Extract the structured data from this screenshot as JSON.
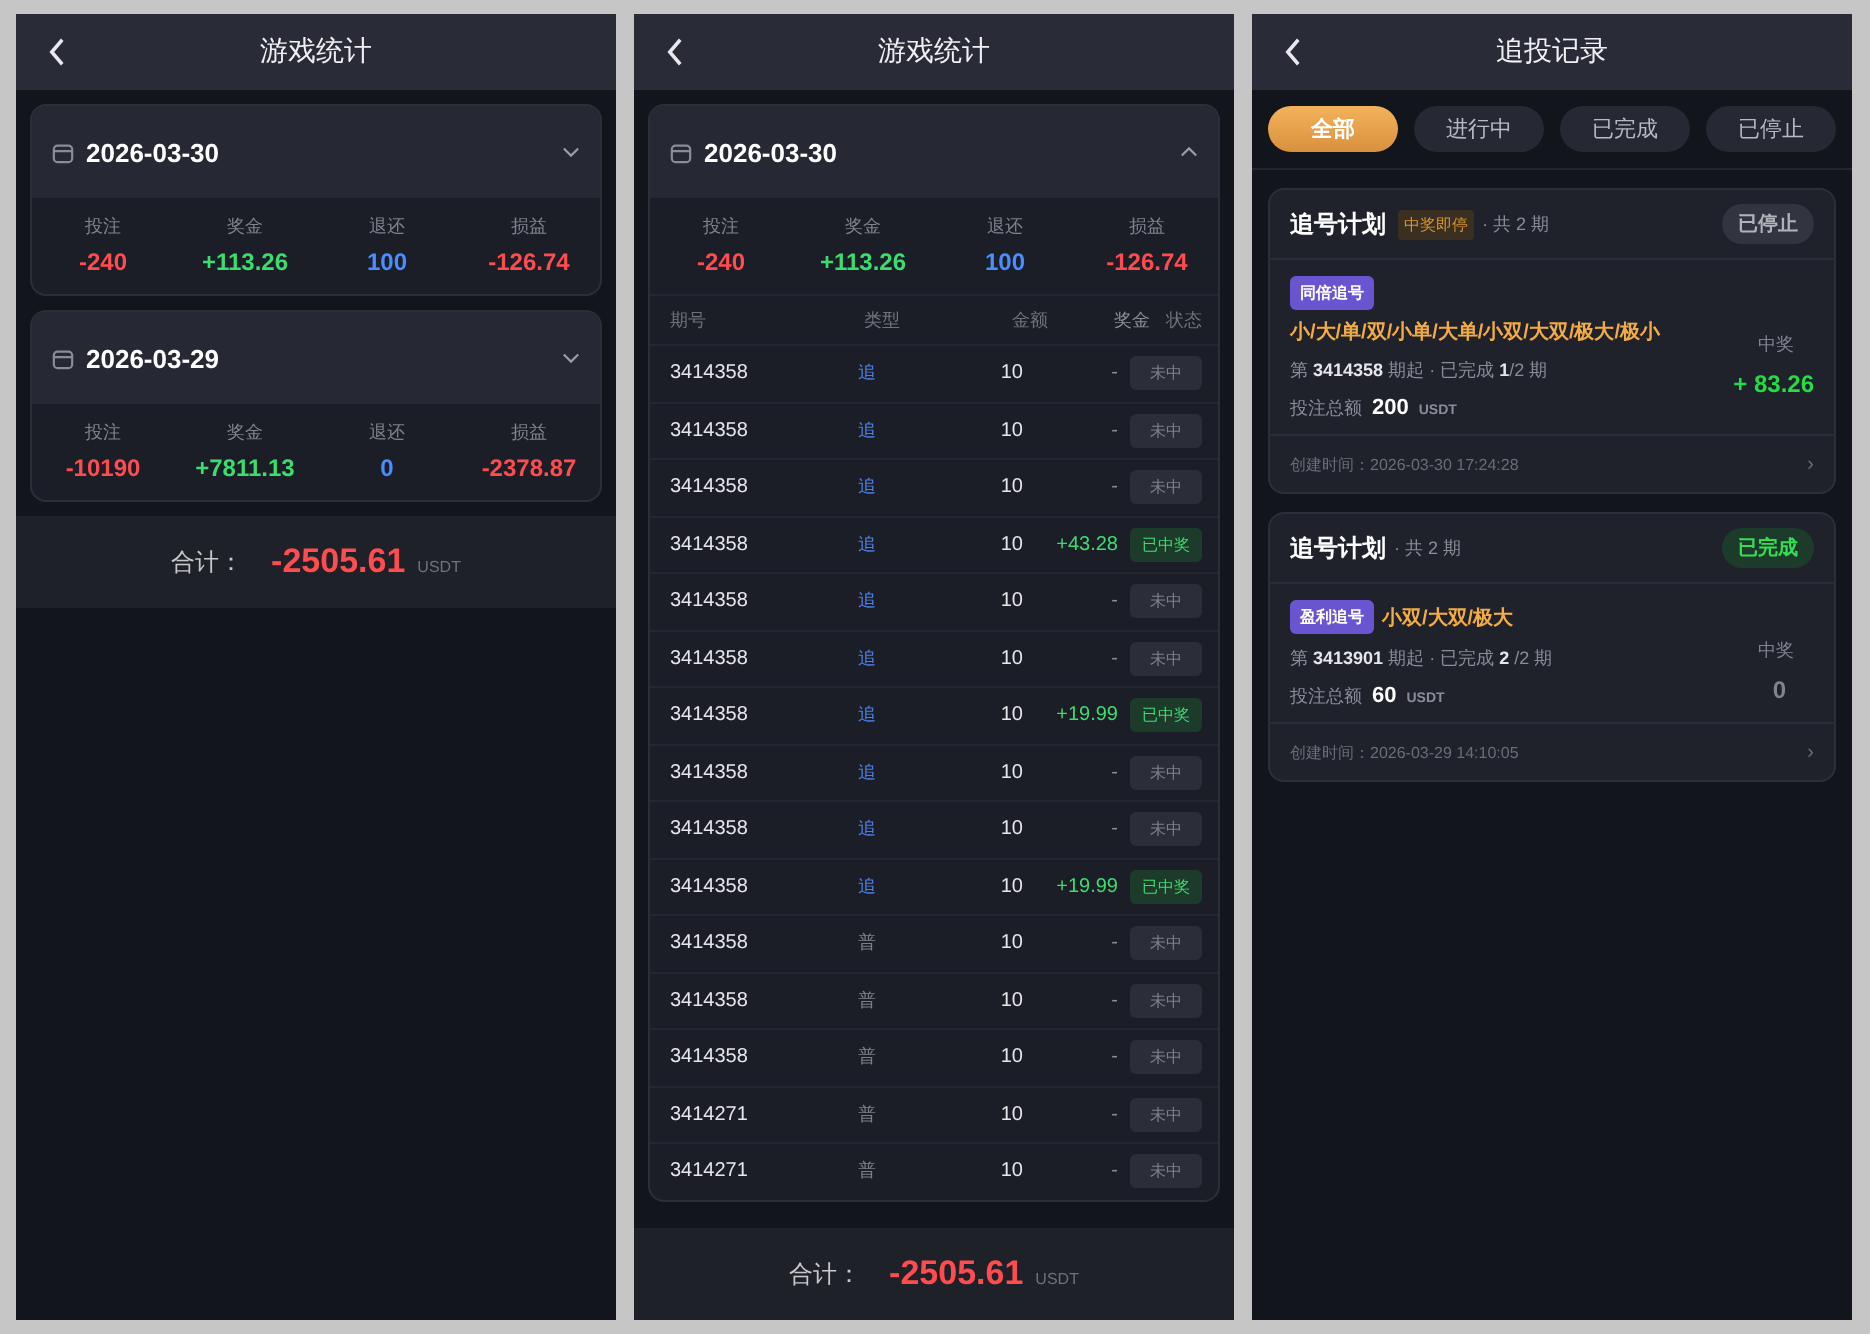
{
  "screens": [
    {
      "kind": "stats",
      "title": "游戏统计",
      "days": [
        {
          "date": "2026-03-30",
          "expanded": false,
          "stats": [
            {
              "label": "投注",
              "value": "-240",
              "color": "#ff4d4f"
            },
            {
              "label": "奖金",
              "value": "+113.26",
              "color": "#3ddc6f"
            },
            {
              "label": "退还",
              "value": "100",
              "color": "#4a8dff"
            },
            {
              "label": "损益",
              "value": "-126.74",
              "color": "#ff4d4f"
            }
          ]
        },
        {
          "date": "2026-03-29",
          "expanded": false,
          "stats": [
            {
              "label": "投注",
              "value": "-10190",
              "color": "#ff4d4f"
            },
            {
              "label": "奖金",
              "value": "+7811.13",
              "color": "#3ddc6f"
            },
            {
              "label": "退还",
              "value": "0",
              "color": "#4a8dff"
            },
            {
              "label": "损益",
              "value": "-2378.87",
              "color": "#ff4d4f"
            }
          ]
        }
      ],
      "total": {
        "label": "合计：",
        "value": "-2505.61",
        "unit": "USDT"
      }
    },
    {
      "kind": "stats",
      "title": "游戏统计",
      "days": [
        {
          "date": "2026-03-30",
          "expanded": true,
          "stats": [
            {
              "label": "投注",
              "value": "-240",
              "color": "#ff4d4f"
            },
            {
              "label": "奖金",
              "value": "+113.26",
              "color": "#3ddc6f"
            },
            {
              "label": "退还",
              "value": "100",
              "color": "#4a8dff"
            },
            {
              "label": "损益",
              "value": "-126.74",
              "color": "#ff4d4f"
            }
          ],
          "table": {
            "columns": [
              "期号",
              "类型",
              "金额",
              "奖金",
              "状态"
            ],
            "rows": [
              {
                "period": "3414358",
                "type": "追",
                "kind": "chase",
                "amount": "10",
                "prize": "-",
                "status": "未中",
                "won": false
              },
              {
                "period": "3414358",
                "type": "追",
                "kind": "chase",
                "amount": "10",
                "prize": "-",
                "status": "未中",
                "won": false
              },
              {
                "period": "3414358",
                "type": "追",
                "kind": "chase",
                "amount": "10",
                "prize": "-",
                "status": "未中",
                "won": false
              },
              {
                "period": "3414358",
                "type": "追",
                "kind": "chase",
                "amount": "10",
                "prize": "+43.28",
                "status": "已中奖",
                "won": true
              },
              {
                "period": "3414358",
                "type": "追",
                "kind": "chase",
                "amount": "10",
                "prize": "-",
                "status": "未中",
                "won": false
              },
              {
                "period": "3414358",
                "type": "追",
                "kind": "chase",
                "amount": "10",
                "prize": "-",
                "status": "未中",
                "won": false
              },
              {
                "period": "3414358",
                "type": "追",
                "kind": "chase",
                "amount": "10",
                "prize": "+19.99",
                "status": "已中奖",
                "won": true
              },
              {
                "period": "3414358",
                "type": "追",
                "kind": "chase",
                "amount": "10",
                "prize": "-",
                "status": "未中",
                "won": false
              },
              {
                "period": "3414358",
                "type": "追",
                "kind": "chase",
                "amount": "10",
                "prize": "-",
                "status": "未中",
                "won": false
              },
              {
                "period": "3414358",
                "type": "追",
                "kind": "chase",
                "amount": "10",
                "prize": "+19.99",
                "status": "已中奖",
                "won": true
              },
              {
                "period": "3414358",
                "type": "普",
                "kind": "normal",
                "amount": "10",
                "prize": "-",
                "status": "未中",
                "won": false
              },
              {
                "period": "3414358",
                "type": "普",
                "kind": "normal",
                "amount": "10",
                "prize": "-",
                "status": "未中",
                "won": false
              },
              {
                "period": "3414358",
                "type": "普",
                "kind": "normal",
                "amount": "10",
                "prize": "-",
                "status": "未中",
                "won": false
              },
              {
                "period": "3414271",
                "type": "普",
                "kind": "normal",
                "amount": "10",
                "prize": "-",
                "status": "未中",
                "won": false
              },
              {
                "period": "3414271",
                "type": "普",
                "kind": "normal",
                "amount": "10",
                "prize": "-",
                "status": "未中",
                "won": false
              }
            ]
          }
        }
      ],
      "total": {
        "label": "合计：",
        "value": "-2505.61",
        "unit": "USDT"
      }
    },
    {
      "kind": "records",
      "title": "追投记录",
      "filters": [
        {
          "label": "全部",
          "selected": true
        },
        {
          "label": "进行中",
          "selected": false
        },
        {
          "label": "已完成",
          "selected": false
        },
        {
          "label": "已停止",
          "selected": false
        }
      ],
      "records": [
        {
          "title": "追号计划",
          "tag": "中奖即停",
          "periods": "· 共 2 期",
          "status": "已停止",
          "kind": "stopped",
          "mode": "同倍追号",
          "picks": "小/大/单/双/小单/大单/小双/大双/极大/极小",
          "progress": "第 **3414358** 期起 · 已完成 **1**/2 期",
          "total_label": "投注总额",
          "total": "200",
          "unit": "USDT",
          "prize_label": "中奖",
          "prize": "+ 83.26",
          "won": true,
          "created": "创建时间：2026-03-30 17:24:28",
          "arrow": "›"
        },
        {
          "title": "追号计划",
          "periods": "· 共 2 期",
          "status": "已完成",
          "kind": "done",
          "mode": "盈利追号",
          "picks": "小双/大双/极大",
          "progress": "第 **3413901** 期起 · 已完成 **2** /2 期",
          "total_label": "投注总额",
          "total": "60",
          "unit": "USDT",
          "prize_label": "中奖",
          "prize": "0",
          "won": false,
          "created": "创建时间：2026-03-29 14:10:05",
          "arrow": "›"
        }
      ]
    }
  ]
}
